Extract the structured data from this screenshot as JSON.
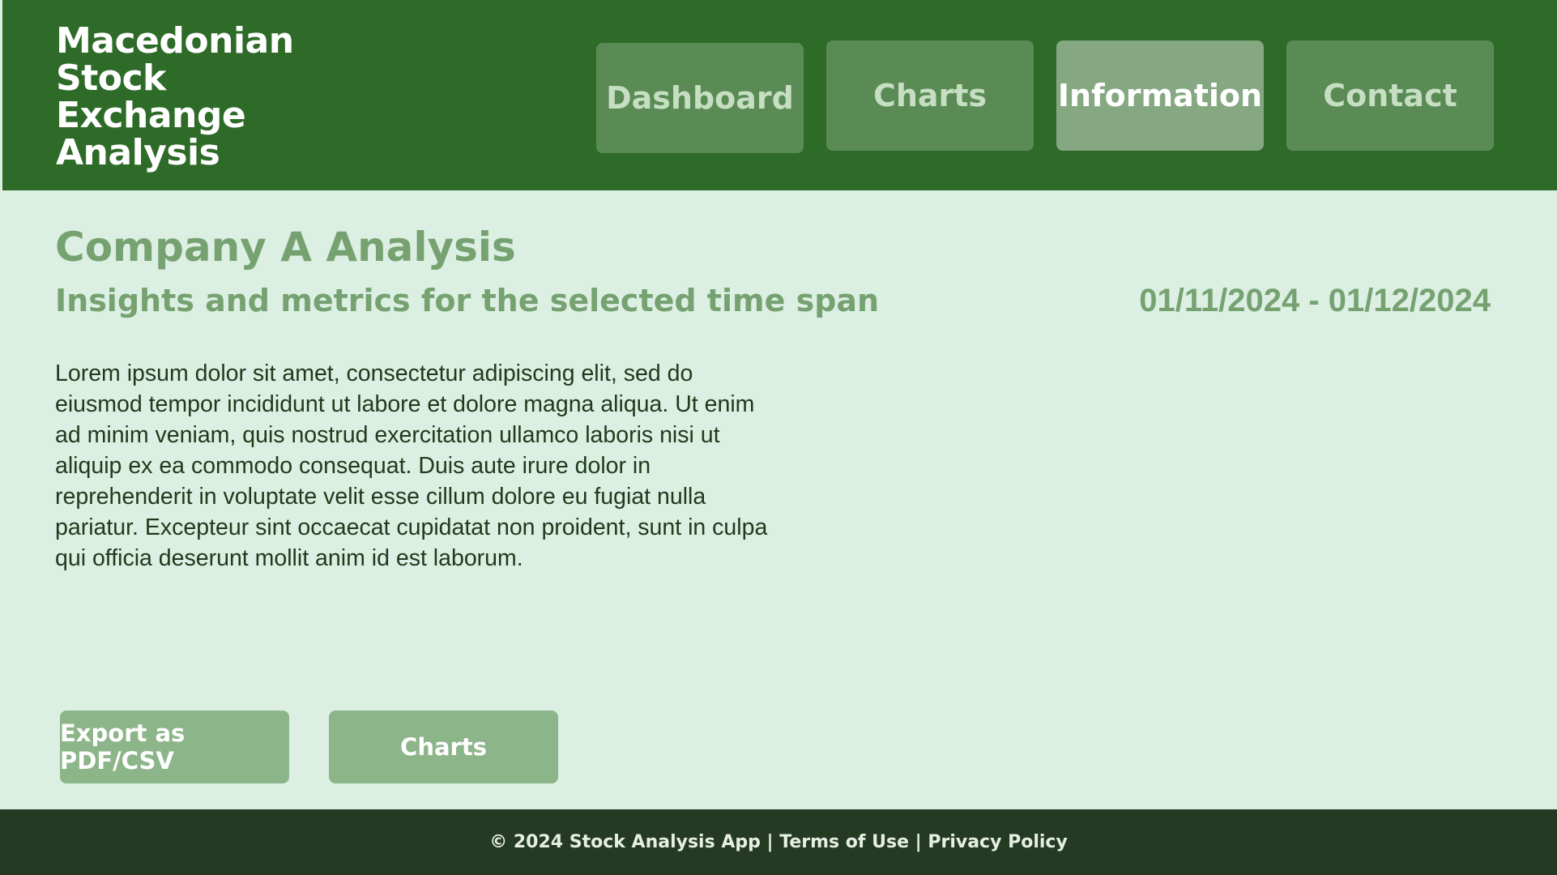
{
  "header": {
    "brand_lines": [
      "Macedonian",
      "Stock",
      "Exchange",
      "Analysis"
    ],
    "nav": [
      {
        "label": "Dashboard",
        "active": false
      },
      {
        "label": "Charts",
        "active": false
      },
      {
        "label": "Information",
        "active": true
      },
      {
        "label": "Contact",
        "active": false
      }
    ]
  },
  "main": {
    "title": "Company A Analysis",
    "subtitle": "Insights and metrics for the selected time span",
    "date_range": "01/11/2024 - 01/12/2024",
    "body": "Lorem ipsum dolor sit amet, consectetur adipiscing elit, sed do eiusmod tempor incididunt ut labore et dolore magna aliqua. Ut enim ad minim veniam, quis nostrud exercitation ullamco laboris nisi ut aliquip ex ea commodo consequat. Duis aute irure dolor in reprehenderit in voluptate velit esse cillum dolore eu fugiat nulla pariatur. Excepteur sint occaecat cupidatat non proident, sunt in culpa qui officia deserunt mollit anim id est laborum.",
    "buttons": {
      "export_label": "Export as PDF/CSV",
      "charts_label": "Charts"
    }
  },
  "footer": {
    "copyright": "© 2024 Stock Analysis App",
    "separator": " | ",
    "terms": "Terms of Use",
    "privacy": "Privacy Policy"
  },
  "colors": {
    "header_bg": "#2e6b28",
    "nav_button": "#5a8b55",
    "nav_active": "#85a882",
    "main_bg": "#dcefe3",
    "accent_text": "#76a271",
    "action_button": "#8db58a",
    "footer_bg": "#243a23"
  }
}
